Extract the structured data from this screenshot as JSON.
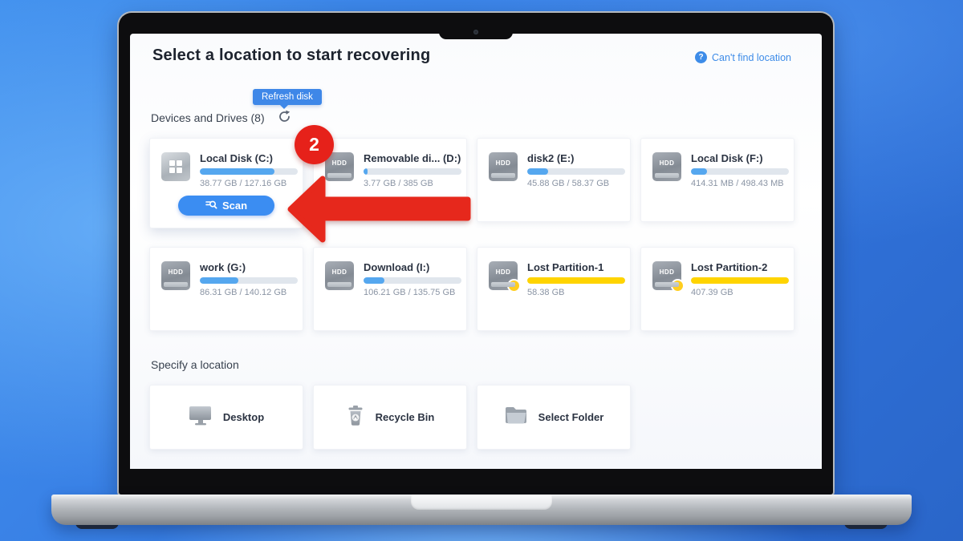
{
  "window": {
    "title": "Select a location to start recovering",
    "help_link": "Can't find location",
    "help_icon_glyph": "?"
  },
  "tooltip": {
    "text": "Refresh disk"
  },
  "devices_section": {
    "label": "Devices and Drives (8)"
  },
  "specify_section": {
    "label": "Specify a location"
  },
  "icons": {
    "hdd_label": "HDD"
  },
  "drives": [
    {
      "name": "Local Disk (C:)",
      "size": "38.77 GB / 127.16 GB",
      "fill_percent": 76,
      "bar_color": "#55a7ef",
      "icon": "windows-drive",
      "scan_label": "Scan"
    },
    {
      "name": "Removable di... (D:)",
      "size": "3.77 GB / 385 GB",
      "fill_percent": 4,
      "bar_color": "#55a7ef",
      "icon": "hdd"
    },
    {
      "name": "disk2 (E:)",
      "size": "45.88 GB / 58.37 GB",
      "fill_percent": 21,
      "bar_color": "#55a7ef",
      "icon": "hdd"
    },
    {
      "name": "Local Disk (F:)",
      "size": "414.31 MB / 498.43 MB",
      "fill_percent": 16,
      "bar_color": "#55a7ef",
      "icon": "hdd"
    },
    {
      "name": "work (G:)",
      "size": "86.31 GB / 140.12 GB",
      "fill_percent": 39,
      "bar_color": "#55a7ef",
      "icon": "hdd"
    },
    {
      "name": "Download (I:)",
      "size": "106.21 GB / 135.75 GB",
      "fill_percent": 21,
      "bar_color": "#55a7ef",
      "icon": "hdd"
    },
    {
      "name": "Lost Partition-1",
      "size": "58.38 GB",
      "fill_percent": 100,
      "bar_color": "#ffd400",
      "icon": "hdd-lost"
    },
    {
      "name": "Lost Partition-2",
      "size": "407.39 GB",
      "fill_percent": 100,
      "bar_color": "#ffd400",
      "icon": "hdd-lost"
    }
  ],
  "locations": [
    {
      "label": "Desktop",
      "icon": "desktop-icon"
    },
    {
      "label": "Recycle Bin",
      "icon": "recycle-bin-icon"
    },
    {
      "label": "Select Folder",
      "icon": "folder-icon"
    }
  ],
  "annotations": {
    "step_badge": "2"
  },
  "colors": {
    "accent_blue": "#3b8df2",
    "link_blue": "#3d8ce8",
    "tooltip_blue": "#3e87e8",
    "bar_blue": "#55a7ef",
    "bar_yellow": "#ffd400",
    "annotation_red": "#e6281c"
  }
}
